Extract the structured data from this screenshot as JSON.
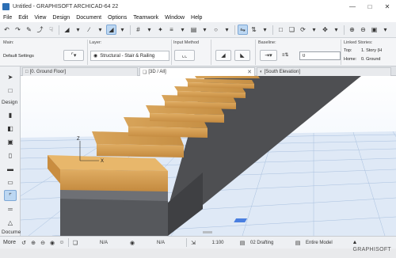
{
  "window": {
    "title": "Untitled - GRAPHISOFT ARCHICAD-64 22"
  },
  "menu": [
    "File",
    "Edit",
    "View",
    "Design",
    "Document",
    "Options",
    "Teamwork",
    "Window",
    "Help"
  ],
  "infobox": {
    "main_label": "Main:",
    "main_value": "Default Settings",
    "layer_label": "Layer:",
    "layer_value": "Structural - Stair & Railing",
    "input_label": "Input Method",
    "baseline_label": "Baseline:",
    "baseline_value": "0",
    "linked_label": "Linked Stories:",
    "top_label": "Top:",
    "top_value": "1. Story (H",
    "home_label": "Home:",
    "home_value": "0. Ground"
  },
  "toolbox": {
    "design_label": "Design",
    "document_label": "Docume",
    "more_label": "More"
  },
  "tabs": [
    {
      "label": "[0. Ground Floor]"
    },
    {
      "label": "[3D / All]"
    },
    {
      "label": "[South Elevation]"
    }
  ],
  "viewport": {
    "axis_z": "Z",
    "axis_x": "X"
  },
  "status": {
    "na1": "N/A",
    "na2": "N/A",
    "scale": "1:100",
    "layer_combo": "02 Drafting",
    "model_view": "Entire Model"
  },
  "brand": "GRAPHISOFT"
}
